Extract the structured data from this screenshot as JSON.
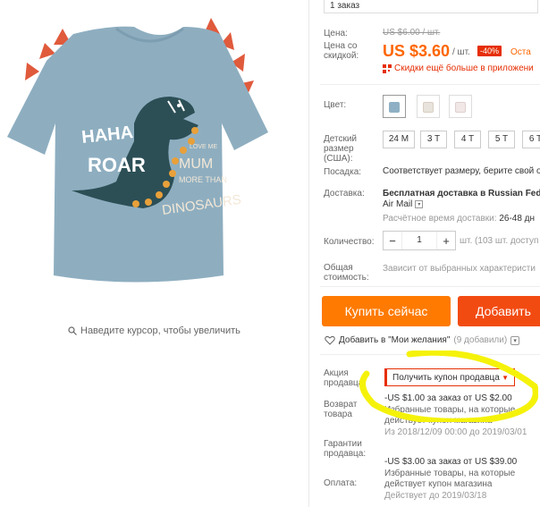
{
  "order": {
    "count_label": "1 заказ"
  },
  "price": {
    "label": "Цена:",
    "old": "US $6.00 / шт.",
    "discount_label": "Цена со скидкой:",
    "new": "US $3.60",
    "per_unit": "/ шт.",
    "discount_badge": "-40%",
    "stock_text": "Оста",
    "app_promo": "Скидки ещё больше в приложени"
  },
  "color": {
    "label": "Цвет:",
    "swatches": [
      {
        "name": "blue",
        "color": "#8fb0c4"
      },
      {
        "name": "white-dino",
        "color": "#e8e3dc"
      },
      {
        "name": "white-pink",
        "color": "#f1e7e7"
      }
    ]
  },
  "size": {
    "label": "Детский размер (США):",
    "options": [
      "24 M",
      "3 T",
      "4 T",
      "5 T",
      "6 T"
    ]
  },
  "fit": {
    "label": "Посадка:",
    "value": "Соответствует размеру, берите свой о"
  },
  "shipping": {
    "label": "Доставка:",
    "method": "Бесплатная доставка в Russian Fed",
    "carrier": "Air Mail",
    "time_label": "Расчётное время доставки:",
    "time_value": "26-48 дн"
  },
  "quantity": {
    "label": "Количество:",
    "value": "1",
    "note": "шт. (103 шт. доступ"
  },
  "total": {
    "label": "Общая стоимость:",
    "value": "Зависит от выбранных характеристи"
  },
  "actions": {
    "buy": "Купить сейчас",
    "cart": "Добавить"
  },
  "wishlist": {
    "label": "Добавить в \"Мои желания\"",
    "count": "(9 добавили)"
  },
  "promo": {
    "label": "Акция продавца:",
    "select": "Получить купон продавца",
    "coupons": [
      {
        "title": "-US $1.00 за заказ от US $2.00",
        "desc": "Избранные товары, на которые действует купон магазина",
        "date": "Из 2018/12/09 00:00 до 2019/03/01"
      },
      {
        "title": "-US $3.00 за заказ от US $39.00",
        "desc": "Избранные товары, на которые действует купон магазина",
        "date": "Действует до 2019/03/18"
      }
    ]
  },
  "side_labels": {
    "return": "Возврат товара",
    "guarantee": "Гарантии продавца:",
    "payment": "Оплата:"
  },
  "zoom_hint": "Наведите курсор, чтобы увеличить",
  "product_image": {
    "shirt_text_1": "HAHA",
    "shirt_text_2": "ROAR",
    "shirt_text_3": "LOVE ME",
    "shirt_text_4": "MUM",
    "shirt_text_5": "MORE THAN",
    "shirt_text_6": "DINOSAURS"
  },
  "colors": {
    "accent_orange": "#ff7a00",
    "accent_red": "#f24b12",
    "shirt_blue": "#8aaabb",
    "spikes": "#e05a3c",
    "highlight": "#f5f20a"
  }
}
